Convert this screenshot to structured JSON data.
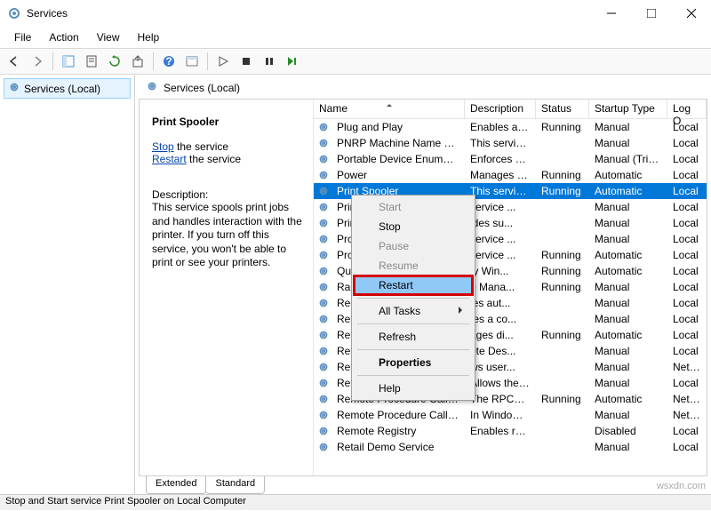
{
  "window": {
    "title": "Services"
  },
  "menu": {
    "file": "File",
    "action": "Action",
    "view": "View",
    "help": "Help"
  },
  "tree": {
    "root": "Services (Local)"
  },
  "panel": {
    "header": "Services (Local)"
  },
  "selected": {
    "name": "Print Spooler",
    "stop_label": "Stop",
    "stop_suffix": " the service",
    "restart_label": "Restart",
    "restart_suffix": " the service",
    "desc_label": "Description:",
    "desc": "This service spools print jobs and handles interaction with the printer. If you turn off this service, you won't be able to print or see your printers."
  },
  "cols": {
    "name": "Name",
    "desc": "Description",
    "status": "Status",
    "startup": "Startup Type",
    "logon": "Log O"
  },
  "rows": [
    {
      "n": "Plug and Play",
      "d": "Enables a c...",
      "s": "Running",
      "t": "Manual",
      "l": "Local"
    },
    {
      "n": "PNRP Machine Name Publi...",
      "d": "This service ...",
      "s": "",
      "t": "Manual",
      "l": "Local"
    },
    {
      "n": "Portable Device Enumerator...",
      "d": "Enforces gr...",
      "s": "",
      "t": "Manual (Trig...",
      "l": "Local"
    },
    {
      "n": "Power",
      "d": "Manages p...",
      "s": "Running",
      "t": "Automatic",
      "l": "Local"
    },
    {
      "n": "Print Spooler",
      "d": "This service ...",
      "s": "Running",
      "t": "Automatic",
      "l": "Local",
      "sel": true
    },
    {
      "n": "Printer Extensions",
      "d": "              service ...",
      "s": "",
      "t": "Manual",
      "l": "Local"
    },
    {
      "n": "PrintWorkflow",
      "d": "              ides su...",
      "s": "",
      "t": "Manual",
      "l": "Local"
    },
    {
      "n": "Problem Reports",
      "d": "              service ...",
      "s": "",
      "t": "Manual",
      "l": "Local"
    },
    {
      "n": "Program Compatibility",
      "d": "              service ...",
      "s": "Running",
      "t": "Automatic",
      "l": "Local"
    },
    {
      "n": "Quality Windows",
      "d": "              ty Win...",
      "s": "Running",
      "t": "Automatic",
      "l": "Local"
    },
    {
      "n": "Radio Management",
      "d": "              o Mana...",
      "s": "Running",
      "t": "Manual",
      "l": "Local"
    },
    {
      "n": "Recommended Troublesh...",
      "d": "              les aut...",
      "s": "",
      "t": "Manual",
      "l": "Local"
    },
    {
      "n": "Remote Access Auto Conn...",
      "d": "              tes a co...",
      "s": "",
      "t": "Manual",
      "l": "Local"
    },
    {
      "n": "Remote Access Connection",
      "d": "              ages di...",
      "s": "Running",
      "t": "Automatic",
      "l": "Local"
    },
    {
      "n": "Remote Desktop Configur...",
      "d": "              ote Des...",
      "s": "",
      "t": "Manual",
      "l": "Local"
    },
    {
      "n": "Remote Desktop Services",
      "d": "              ws user...",
      "s": "",
      "t": "Manual",
      "l": "Netwo"
    },
    {
      "n": "Remote Desktop Services U...",
      "d": "Allows the ...",
      "s": "",
      "t": "Manual",
      "l": "Local"
    },
    {
      "n": "Remote Procedure Call (RPC)",
      "d": "The RPCSS s...",
      "s": "Running",
      "t": "Automatic",
      "l": "Netwo"
    },
    {
      "n": "Remote Procedure Call (R...",
      "d": "In Windows...",
      "s": "",
      "t": "Manual",
      "l": "Netwo"
    },
    {
      "n": "Remote Registry",
      "d": "Enables rem...",
      "s": "",
      "t": "Disabled",
      "l": "Local"
    },
    {
      "n": "Retail Demo Service",
      "d": "",
      "s": "",
      "t": "Manual",
      "l": "Local"
    }
  ],
  "ctx": {
    "start": "Start",
    "stop": "Stop",
    "pause": "Pause",
    "resume": "Resume",
    "restart": "Restart",
    "alltasks": "All Tasks",
    "refresh": "Refresh",
    "properties": "Properties",
    "help": "Help"
  },
  "tabs": {
    "extended": "Extended",
    "standard": "Standard"
  },
  "status": "Stop and Start service Print Spooler on Local Computer",
  "watermark": "wsxdn.com"
}
